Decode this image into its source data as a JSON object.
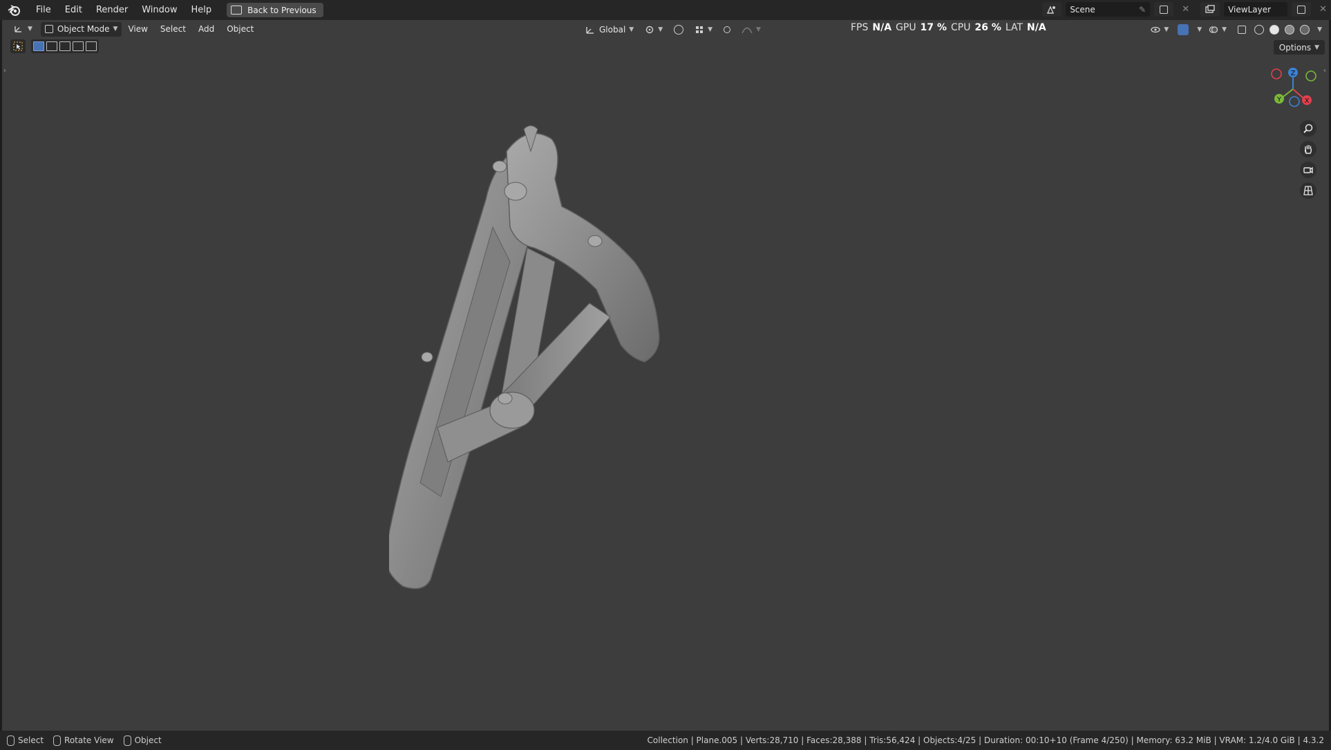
{
  "topbar": {
    "menus": [
      "File",
      "Edit",
      "Render",
      "Window",
      "Help"
    ],
    "back_button": "Back to Previous",
    "scene_name": "Scene",
    "view_layer": "ViewLayer"
  },
  "viewport_header": {
    "mode": "Object Mode",
    "menus": [
      "View",
      "Select",
      "Add",
      "Object"
    ],
    "transform_orientation": "Global",
    "options_label": "Options"
  },
  "stats": {
    "fps_label": "FPS",
    "fps_value": "N/A",
    "gpu_label": "GPU",
    "gpu_value": "17 %",
    "cpu_label": "CPU",
    "cpu_value": "26 %",
    "lat_label": "LAT",
    "lat_value": "N/A"
  },
  "gizmo": {
    "z": "Z",
    "y": "Y",
    "x": "X",
    "colors": {
      "x": "#e0404e",
      "y": "#7bb83a",
      "z": "#3b82d4"
    }
  },
  "statusbar": {
    "left": [
      "Select",
      "Rotate View",
      "Object"
    ],
    "right": "Collection | Plane.005 | Verts:28,710 | Faces:28,388 | Tris:56,424 | Objects:4/25 | Duration: 00:10+10 (Frame 4/250) | Memory: 63.2 MiB | VRAM: 1.2/4.0 GiB | 4.3.2"
  },
  "colors": {
    "viewport_bg": "#3d3d3d",
    "accent": "#4772b3"
  }
}
